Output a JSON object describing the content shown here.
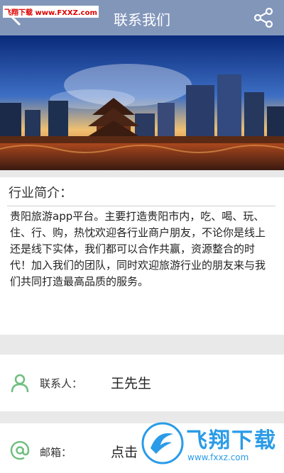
{
  "header": {
    "title": "联系我们",
    "site_tag": "飞翔下载 www.FXXZ.com"
  },
  "intro": {
    "heading": "行业简介：",
    "body": "贵阳旅游app平台。主要打造贵阳市内，吃、喝、玩、住、行、购，热忱欢迎各行业商户朋友，不论你是线上还是线下实体，我们都可以合作共赢，资源整合的时代！加入我们的团队，同时欢迎旅游行业的朋友来与我们共同打造最高品质的服务。"
  },
  "contact": {
    "label": "联系人：",
    "value": "王先生"
  },
  "email": {
    "label": "邮箱：",
    "value": "点击"
  },
  "watermark": {
    "title": "飞翔下载",
    "url": "www.fxxz.com"
  },
  "colors": {
    "topbar": "#8296ba",
    "icon_green": "#6dbf7e"
  },
  "icons": [
    "back-arrow-icon",
    "share-icon",
    "person-icon",
    "at-sign-icon"
  ]
}
